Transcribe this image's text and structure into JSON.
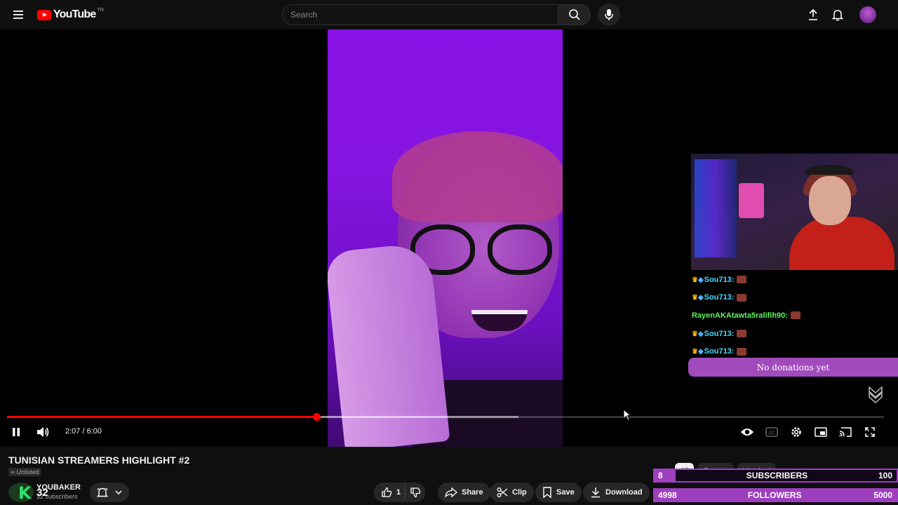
{
  "header": {
    "logo_text": "YouTube",
    "logo_tm": "TN",
    "search_placeholder": "Search"
  },
  "player": {
    "current_time": "2:07",
    "duration": "6:00",
    "time_display": "2:07 / 6:00",
    "played_fraction": 0.353,
    "buffered_fraction": 0.583
  },
  "overlay": {
    "chat": [
      {
        "badges": "👑🧊",
        "user": "Sou713",
        "style": "a"
      },
      {
        "badges": "👑🧊",
        "user": "Sou713",
        "style": "a"
      },
      {
        "badges": "",
        "user": "RayenAKAtawta5ralifih90",
        "style": "b"
      },
      {
        "badges": "👑🧊",
        "user": "Sou713",
        "style": "a"
      },
      {
        "badges": "👑🧊",
        "user": "Sou713",
        "style": "a"
      }
    ],
    "donations_text": "No donations yet",
    "subscribers_goal": {
      "current": "8",
      "label": "SUBSCRIBERS",
      "target": "100",
      "fraction": 0.08
    },
    "followers_goal": {
      "current": "4998",
      "label": "FOLLOWERS",
      "target": "5000",
      "fraction": 0.9996
    }
  },
  "video": {
    "title": "TUNISIAN STREAMERS HIGHLIGHT #2",
    "visibility": "Unlisted",
    "channel_name": "YOUBAKER",
    "channel_subs": "32 subscribers",
    "channel_overlay_number": "32",
    "channel_overlay_letter": "K"
  },
  "actions": {
    "like_count": "1",
    "share": "Share",
    "clip": "Clip",
    "save": "Save",
    "download": "Download"
  },
  "chips": [
    "All",
    "For you",
    "Watched"
  ],
  "colors": {
    "accent_red": "#ff0000",
    "overlay_purple": "#9d3fbf",
    "donations_purple": "#a24bbd"
  }
}
